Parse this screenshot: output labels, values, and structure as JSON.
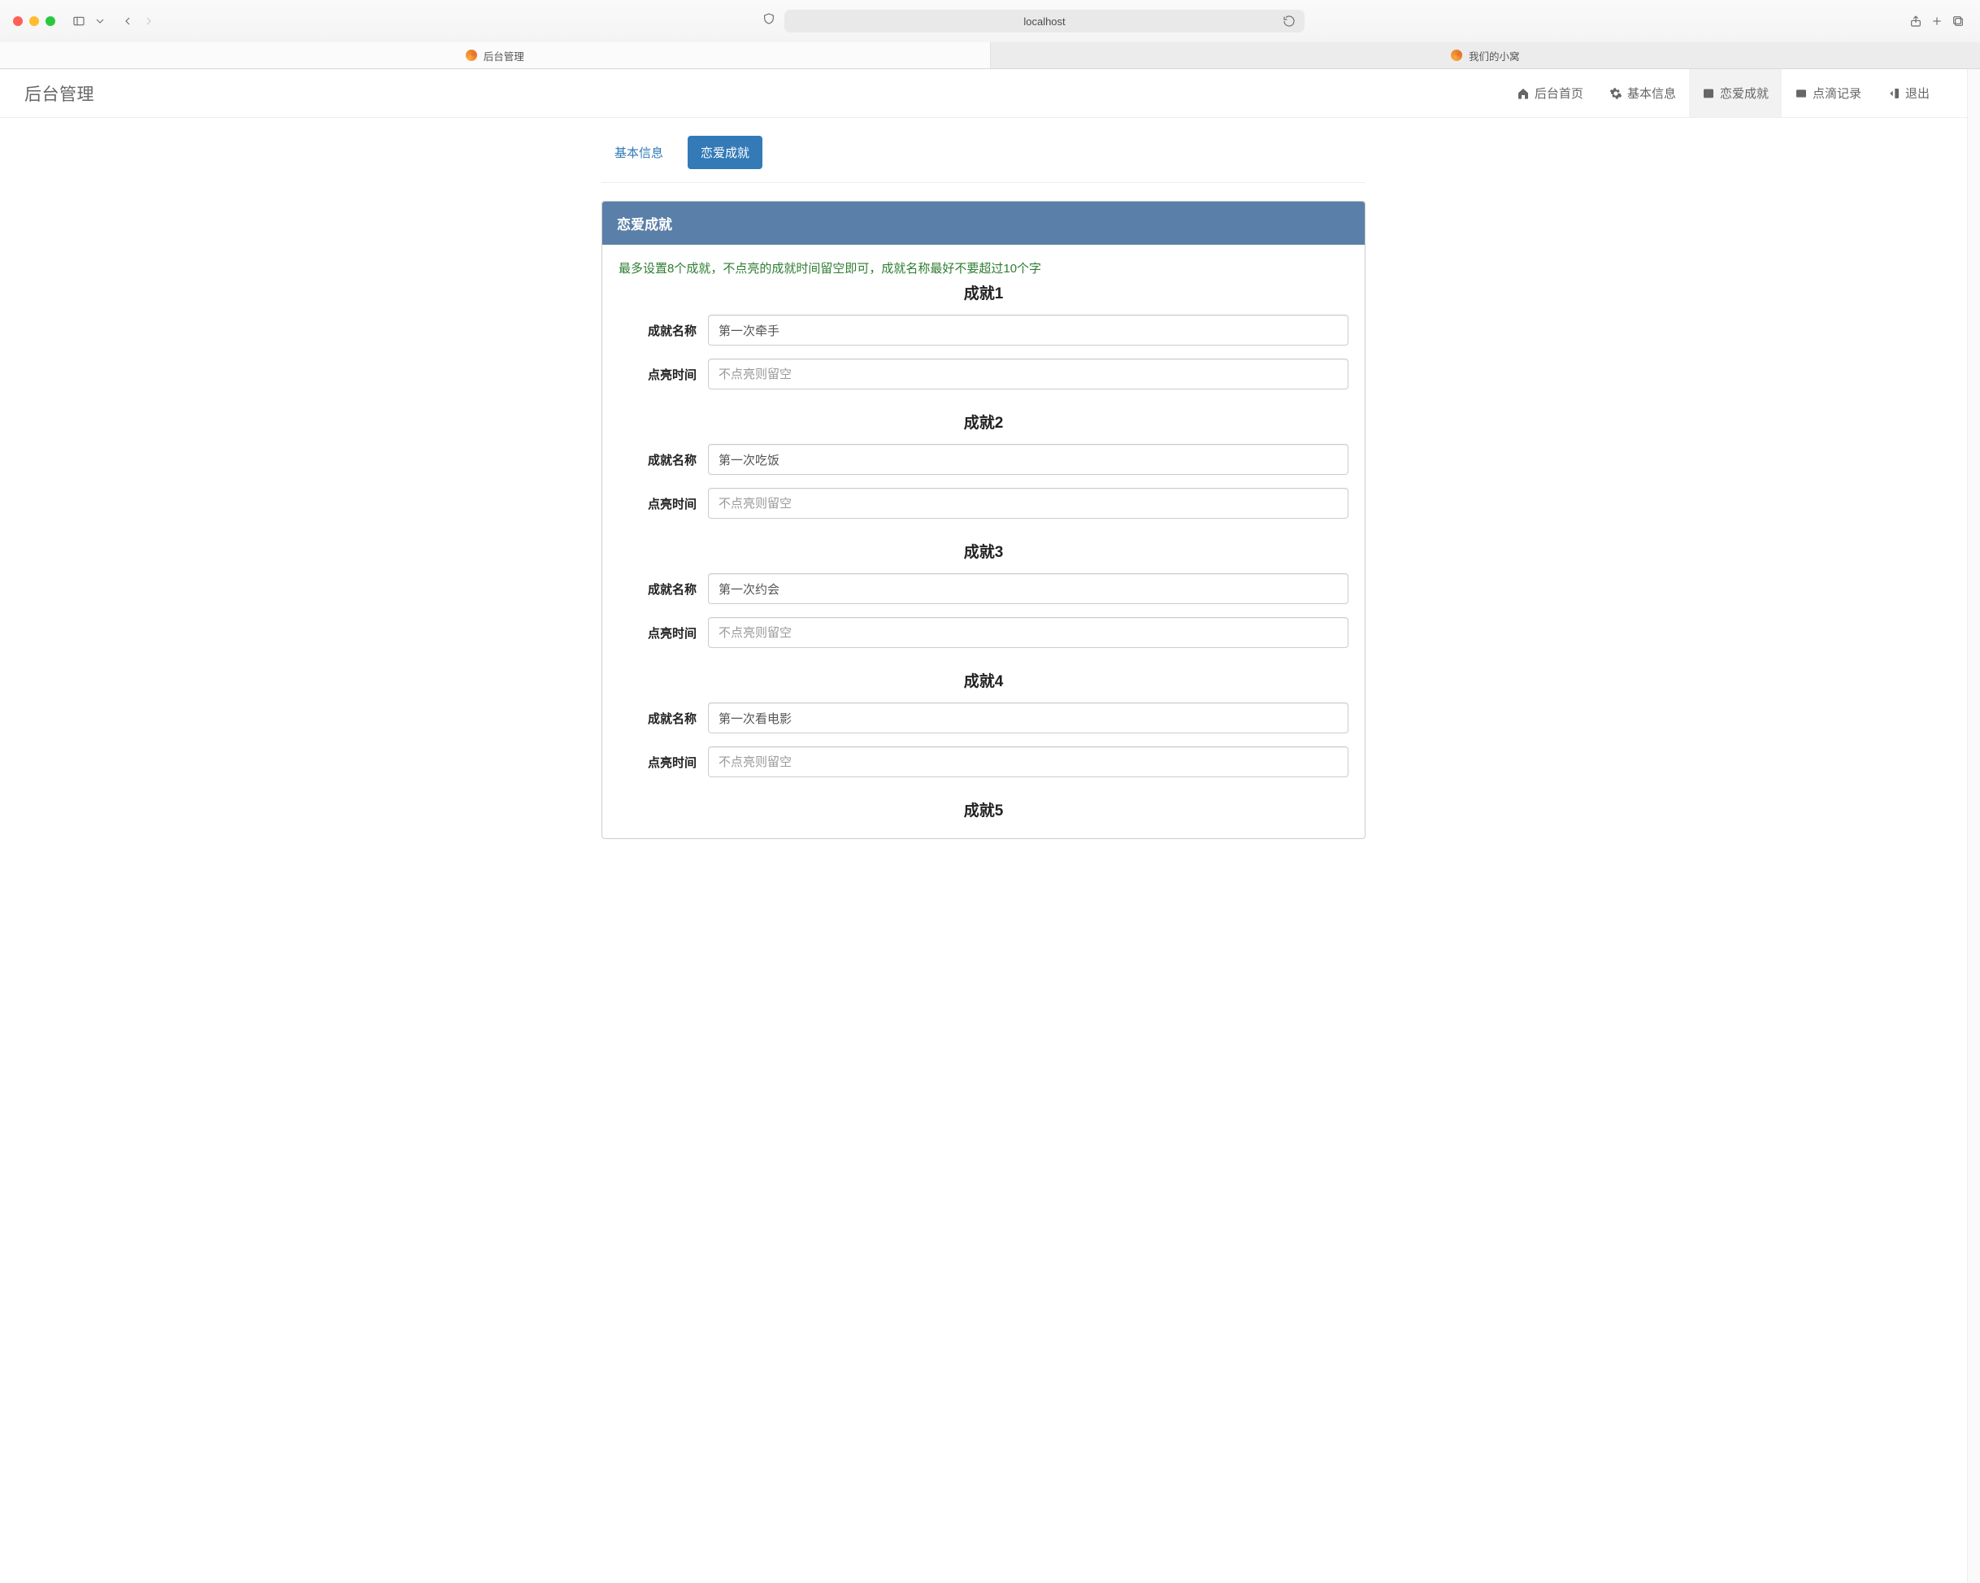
{
  "browser": {
    "address": "localhost",
    "tabs": [
      {
        "label": "后台管理",
        "active": true
      },
      {
        "label": "我们的小窝",
        "active": false
      }
    ]
  },
  "navbar": {
    "brand": "后台管理",
    "links": {
      "home": "后台首页",
      "basic": "基本信息",
      "love": "恋爱成就",
      "log": "点滴记录",
      "exit": "退出"
    },
    "active": "love"
  },
  "subtabs": {
    "basic": "基本信息",
    "love": "恋爱成就",
    "active": "love"
  },
  "panel": {
    "heading": "恋爱成就",
    "hint": "最多设置8个成就，不点亮的成就时间留空即可，成就名称最好不要超过10个字",
    "labels": {
      "name": "成就名称",
      "time": "点亮时间",
      "time_placeholder": "不点亮则留空"
    },
    "achievements": [
      {
        "title": "成就1",
        "name": "第一次牵手",
        "time": ""
      },
      {
        "title": "成就2",
        "name": "第一次吃饭",
        "time": ""
      },
      {
        "title": "成就3",
        "name": "第一次约会",
        "time": ""
      },
      {
        "title": "成就4",
        "name": "第一次看电影",
        "time": ""
      },
      {
        "title": "成就5",
        "name": "",
        "time": ""
      }
    ]
  }
}
